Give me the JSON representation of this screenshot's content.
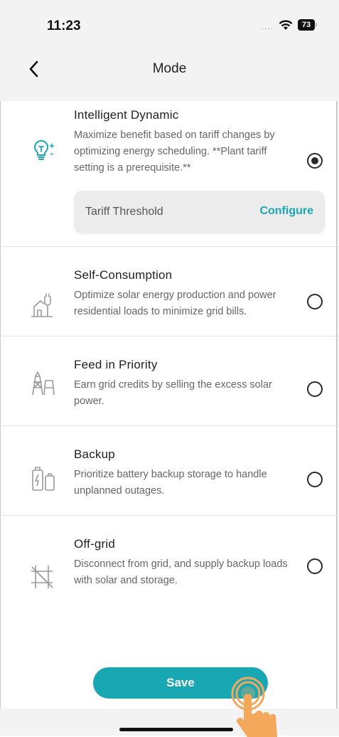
{
  "status_bar": {
    "time": "11:23",
    "signal": "....",
    "battery": "73"
  },
  "nav": {
    "title": "Mode"
  },
  "modes": [
    {
      "title": "Intelligent Dynamic",
      "description": "Maximize benefit based on tariff changes by optimizing energy scheduling. **Plant tariff setting is a prerequisite.**",
      "selected": true,
      "icon": "bulb-sparkle-icon",
      "tariff": {
        "label": "Tariff Threshold",
        "action": "Configure"
      }
    },
    {
      "title": "Self-Consumption",
      "description": "Optimize solar energy production and power residential loads to minimize grid bills.",
      "selected": false,
      "icon": "home-plug-icon"
    },
    {
      "title": "Feed in Priority",
      "description": "Earn grid credits by selling the excess solar power.",
      "selected": false,
      "icon": "power-tower-icon"
    },
    {
      "title": "Backup",
      "description": "Prioritize battery backup storage to handle unplanned outages.",
      "selected": false,
      "icon": "battery-backup-icon"
    },
    {
      "title": "Off-grid",
      "description": "Disconnect from grid, and supply backup loads with solar and storage.",
      "selected": false,
      "icon": "off-grid-icon"
    }
  ],
  "save_label": "Save",
  "colors": {
    "accent": "#1aa7b4",
    "hand": "#f3a85c"
  }
}
